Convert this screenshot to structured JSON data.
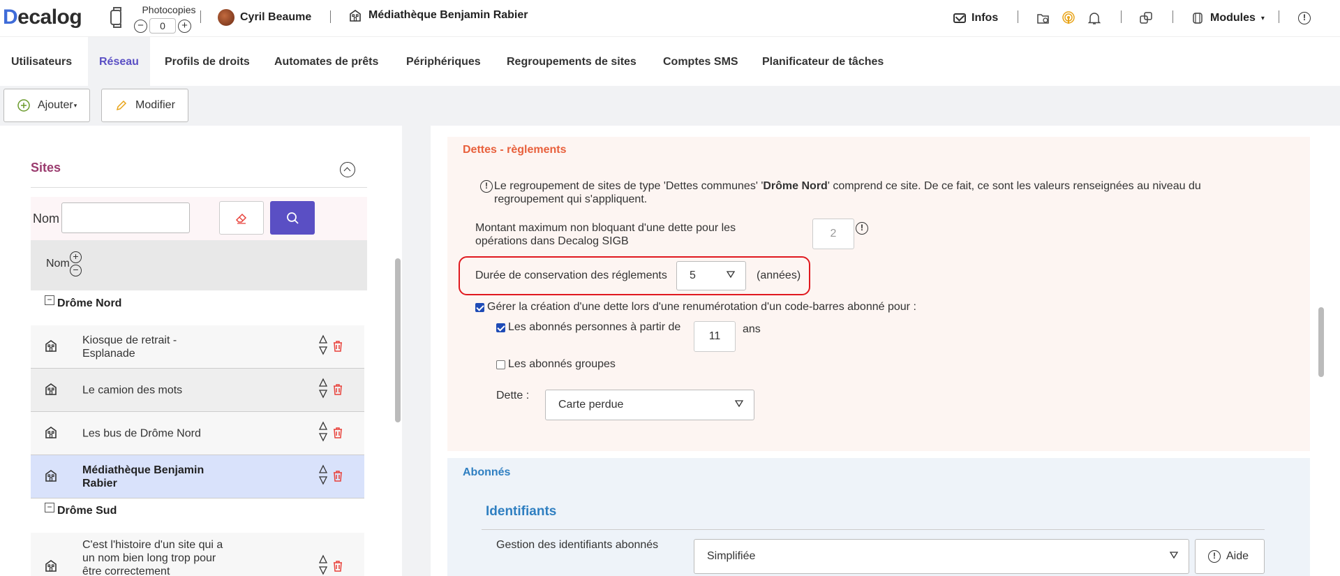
{
  "topbar": {
    "logo": "Decalog",
    "photocopies_label": "Photocopies",
    "photocopies_value": "0",
    "photocopies_minus": "−",
    "photocopies_plus": "+",
    "user_name": "Cyril Beaume",
    "current_site": "Médiathèque Benjamin Rabier",
    "infos_label": "Infos",
    "modules_label": "Modules"
  },
  "nav": {
    "tabs": [
      {
        "label": "Utilisateurs"
      },
      {
        "label": "Réseau",
        "active": true
      },
      {
        "label": "Profils de droits"
      },
      {
        "label": "Automates de prêts"
      },
      {
        "label": "Périphériques"
      },
      {
        "label": "Regroupements de sites"
      },
      {
        "label": "Comptes SMS"
      },
      {
        "label": "Planificateur de tâches"
      }
    ]
  },
  "toolbar": {
    "add_label": "Ajouter",
    "edit_label": "Modifier"
  },
  "sites": {
    "title": "Sites",
    "filter_label": "Nom",
    "filter_value": "",
    "column_header": "Nom",
    "groups": [
      {
        "name": "Drôme Nord",
        "items": [
          {
            "name": "Kiosque de retrait - Esplanade"
          },
          {
            "name": "Le camion des mots"
          },
          {
            "name": "Les bus de Drôme Nord"
          },
          {
            "name": "Médiathèque Benjamin Rabier",
            "selected": true
          }
        ]
      },
      {
        "name": "Drôme Sud",
        "items": [
          {
            "name": "C'est l'histoire d'un site qui a un nom bien long trop pour être correctement"
          }
        ]
      }
    ]
  },
  "dettes": {
    "title": "Dettes - règlements",
    "notice_pre": "Le regroupement de sites de type 'Dettes communes' '",
    "notice_bold": "Drôme Nord",
    "notice_post": "' comprend ce site. De ce fait, ce sont les valeurs renseignées au niveau du regroupement qui s'appliquent.",
    "max_amount_label": "Montant maximum non bloquant d'une dette pour les opérations dans Decalog SIGB",
    "max_amount_value": "2",
    "retention_label": "Durée de conservation des réglements",
    "retention_value": "5",
    "retention_unit": "(années)",
    "renumber_label": "Gérer la création d'une dette lors d'une renumérotation d'un code-barres abonné pour :",
    "renumber_checked": true,
    "persons_label": "Les abonnés personnes à partir de",
    "persons_checked": true,
    "persons_age": "11",
    "persons_unit": "ans",
    "groups_label": "Les abonnés groupes",
    "groups_checked": false,
    "debt_label": "Dette :",
    "debt_value": "Carte perdue"
  },
  "abonnes": {
    "title": "Abonnés",
    "subtitle": "Identifiants",
    "id_mgmt_label": "Gestion des identifiants abonnés",
    "id_mgmt_value": "Simplifiée",
    "help_label": "Aide"
  },
  "colors": {
    "accent": "#5a4fc4",
    "sites_title": "#9a3b6e",
    "dettes_title": "#e8603c",
    "abonnes_title": "#2f7fc1",
    "highlight_frame": "#e0191f",
    "selected_row": "#d9e2fb",
    "delete_icon": "#e8413a"
  }
}
